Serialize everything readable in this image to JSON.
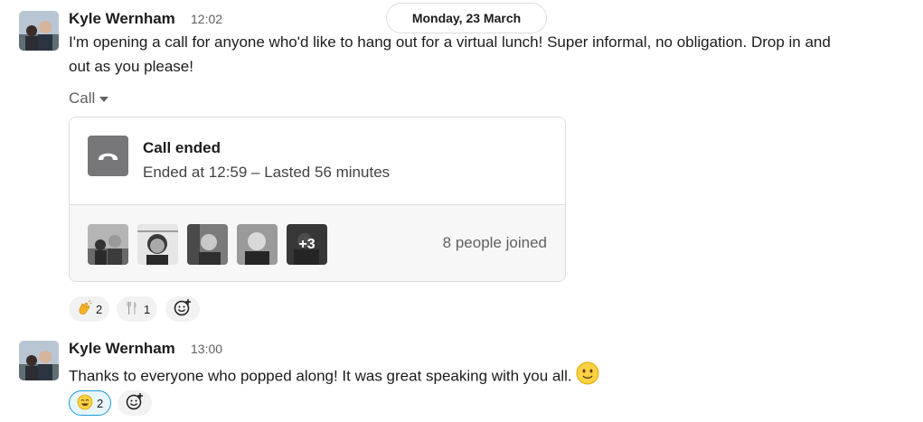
{
  "date_divider": "Monday, 23 March",
  "messages": [
    {
      "author": "Kyle Wernham",
      "time": "12:02",
      "text_line1": "I'm opening a call for anyone who'd like to hang out for a virtual lunch! Super informal, no obligation. Drop in and",
      "text_line2": "out as you please!",
      "call_toggle": "Call",
      "call": {
        "status": "Call ended",
        "detail": "Ended at 12:59 – Lasted 56 minutes",
        "more_count": "+3",
        "joined": "8 people joined"
      },
      "reactions": [
        {
          "emoji": "waving-hand",
          "count": "2"
        },
        {
          "emoji": "fork-and-knife",
          "count": "1"
        }
      ]
    },
    {
      "author": "Kyle Wernham",
      "time": "13:00",
      "text": "Thanks to everyone who popped along! It was great speaking with you all.",
      "reactions": [
        {
          "emoji": "smiling-face",
          "count": "2"
        }
      ]
    }
  ],
  "colors": {
    "text": "#1d1c1d",
    "muted": "#616061",
    "reaction_bg": "#f2f2f2",
    "active_reaction_border": "#1d9bd1",
    "active_reaction_bg": "#e8f5fa"
  }
}
